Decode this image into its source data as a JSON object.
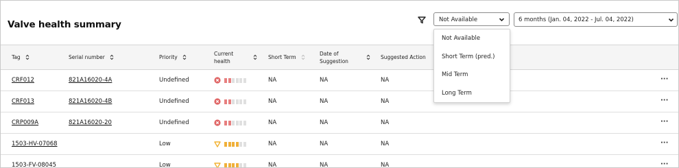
{
  "header": {
    "title": "Valve health summary",
    "filter_icon": "filter-icon",
    "term_select": {
      "value": "Not Available",
      "icon": "chevron-down-icon"
    },
    "period_select": {
      "value": "6 months (Jan. 04, 2022 - Jul. 04, 2022)",
      "icon": "chevron-down-icon"
    }
  },
  "dropdown": {
    "options": [
      "Not Available",
      "Short Term (pred.)",
      "Mid Term",
      "Long Term"
    ]
  },
  "table": {
    "columns": {
      "tag": "Tag",
      "serial": "Serial number",
      "priority": "Priority",
      "health_l1": "Current",
      "health_l2": "health",
      "short_term": "Short Term",
      "date_l1": "Date of",
      "date_l2": "Suggestion",
      "action": "Suggested Action"
    },
    "rows": [
      {
        "tag": "CRF012",
        "serial": "821A16020-4A",
        "priority": "Undefined",
        "health_status": "critical",
        "health_level": 2,
        "short_term": "NA",
        "date": "NA",
        "action": "NA",
        "more": "···"
      },
      {
        "tag": "CRF013",
        "serial": "821A16020-4B",
        "priority": "Undefined",
        "health_status": "critical",
        "health_level": 2,
        "short_term": "NA",
        "date": "NA",
        "action": "NA",
        "more": "···"
      },
      {
        "tag": "CRP009A",
        "serial": "821A16020-20",
        "priority": "Undefined",
        "health_status": "critical",
        "health_level": 2,
        "short_term": "NA",
        "date": "NA",
        "action": "NA",
        "more": "···"
      },
      {
        "tag": "1503-HV-07068",
        "serial": "",
        "priority": "Low",
        "health_status": "warning",
        "health_level": 4,
        "short_term": "NA",
        "date": "NA",
        "action": "NA",
        "more": "···"
      },
      {
        "tag": "1503-FV-08045",
        "serial": "",
        "priority": "Low",
        "health_status": "warning",
        "health_level": 4,
        "short_term": "NA",
        "date": "NA",
        "action": "NA",
        "more": "···"
      }
    ]
  },
  "colors": {
    "critical": "#e06666",
    "critical_bar": "#e77f7f",
    "warning": "#f2b232",
    "warning_bar": "#f0b03a",
    "bar_empty": "#e0e0e0"
  }
}
